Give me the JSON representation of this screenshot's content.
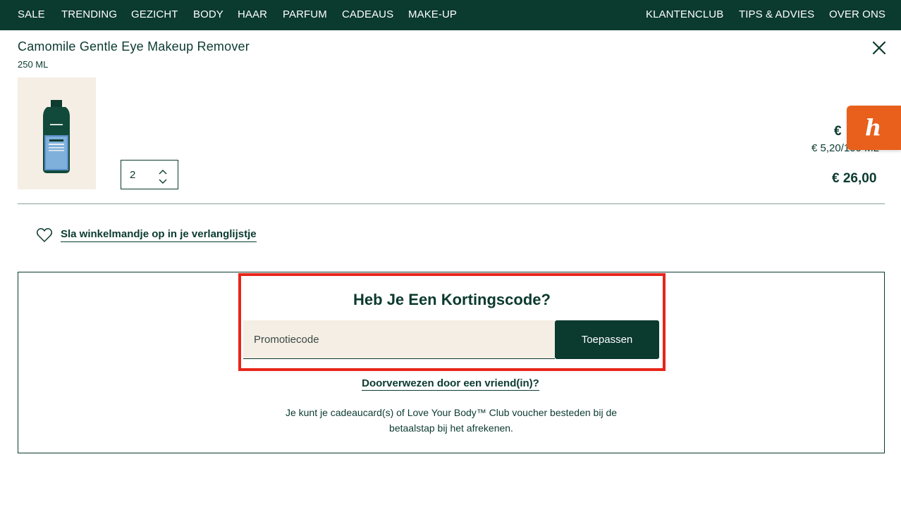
{
  "nav": {
    "left": [
      "SALE",
      "TRENDING",
      "GEZICHT",
      "BODY",
      "HAAR",
      "PARFUM",
      "CADEAUS",
      "MAKE-UP"
    ],
    "right": [
      "KLANTENCLUB",
      "TIPS & ADVIES",
      "OVER ONS"
    ]
  },
  "product": {
    "title": "Camomile Gentle Eye Makeup Remover",
    "size": "250 ML",
    "image_icon": "product-bottle-image",
    "quantity": "2",
    "price_unit_partial": "€",
    "price_per": "€ 5,20/100 ML",
    "price_total": "€ 26,00"
  },
  "wishlist": {
    "icon": "heart-icon",
    "label": "Sla winkelmandje op in je verlanglijstje"
  },
  "promo": {
    "heading": "Heb Je Een Kortingscode?",
    "input_placeholder": "Promotiecode",
    "apply_label": "Toepassen",
    "referral_label": "Doorverwezen door een vriend(in)?",
    "note": "Je kunt je cadeaucard(s) of Love Your Body™ Club voucher besteden bij de betaalstap bij het afrekenen."
  },
  "honey": {
    "icon": "honey-extension-icon",
    "glyph": "h"
  },
  "colors": {
    "brand_green": "#0b3a2f",
    "cream": "#f5eee4",
    "highlight_red": "#e8251a",
    "honey_orange": "#e8601c"
  }
}
